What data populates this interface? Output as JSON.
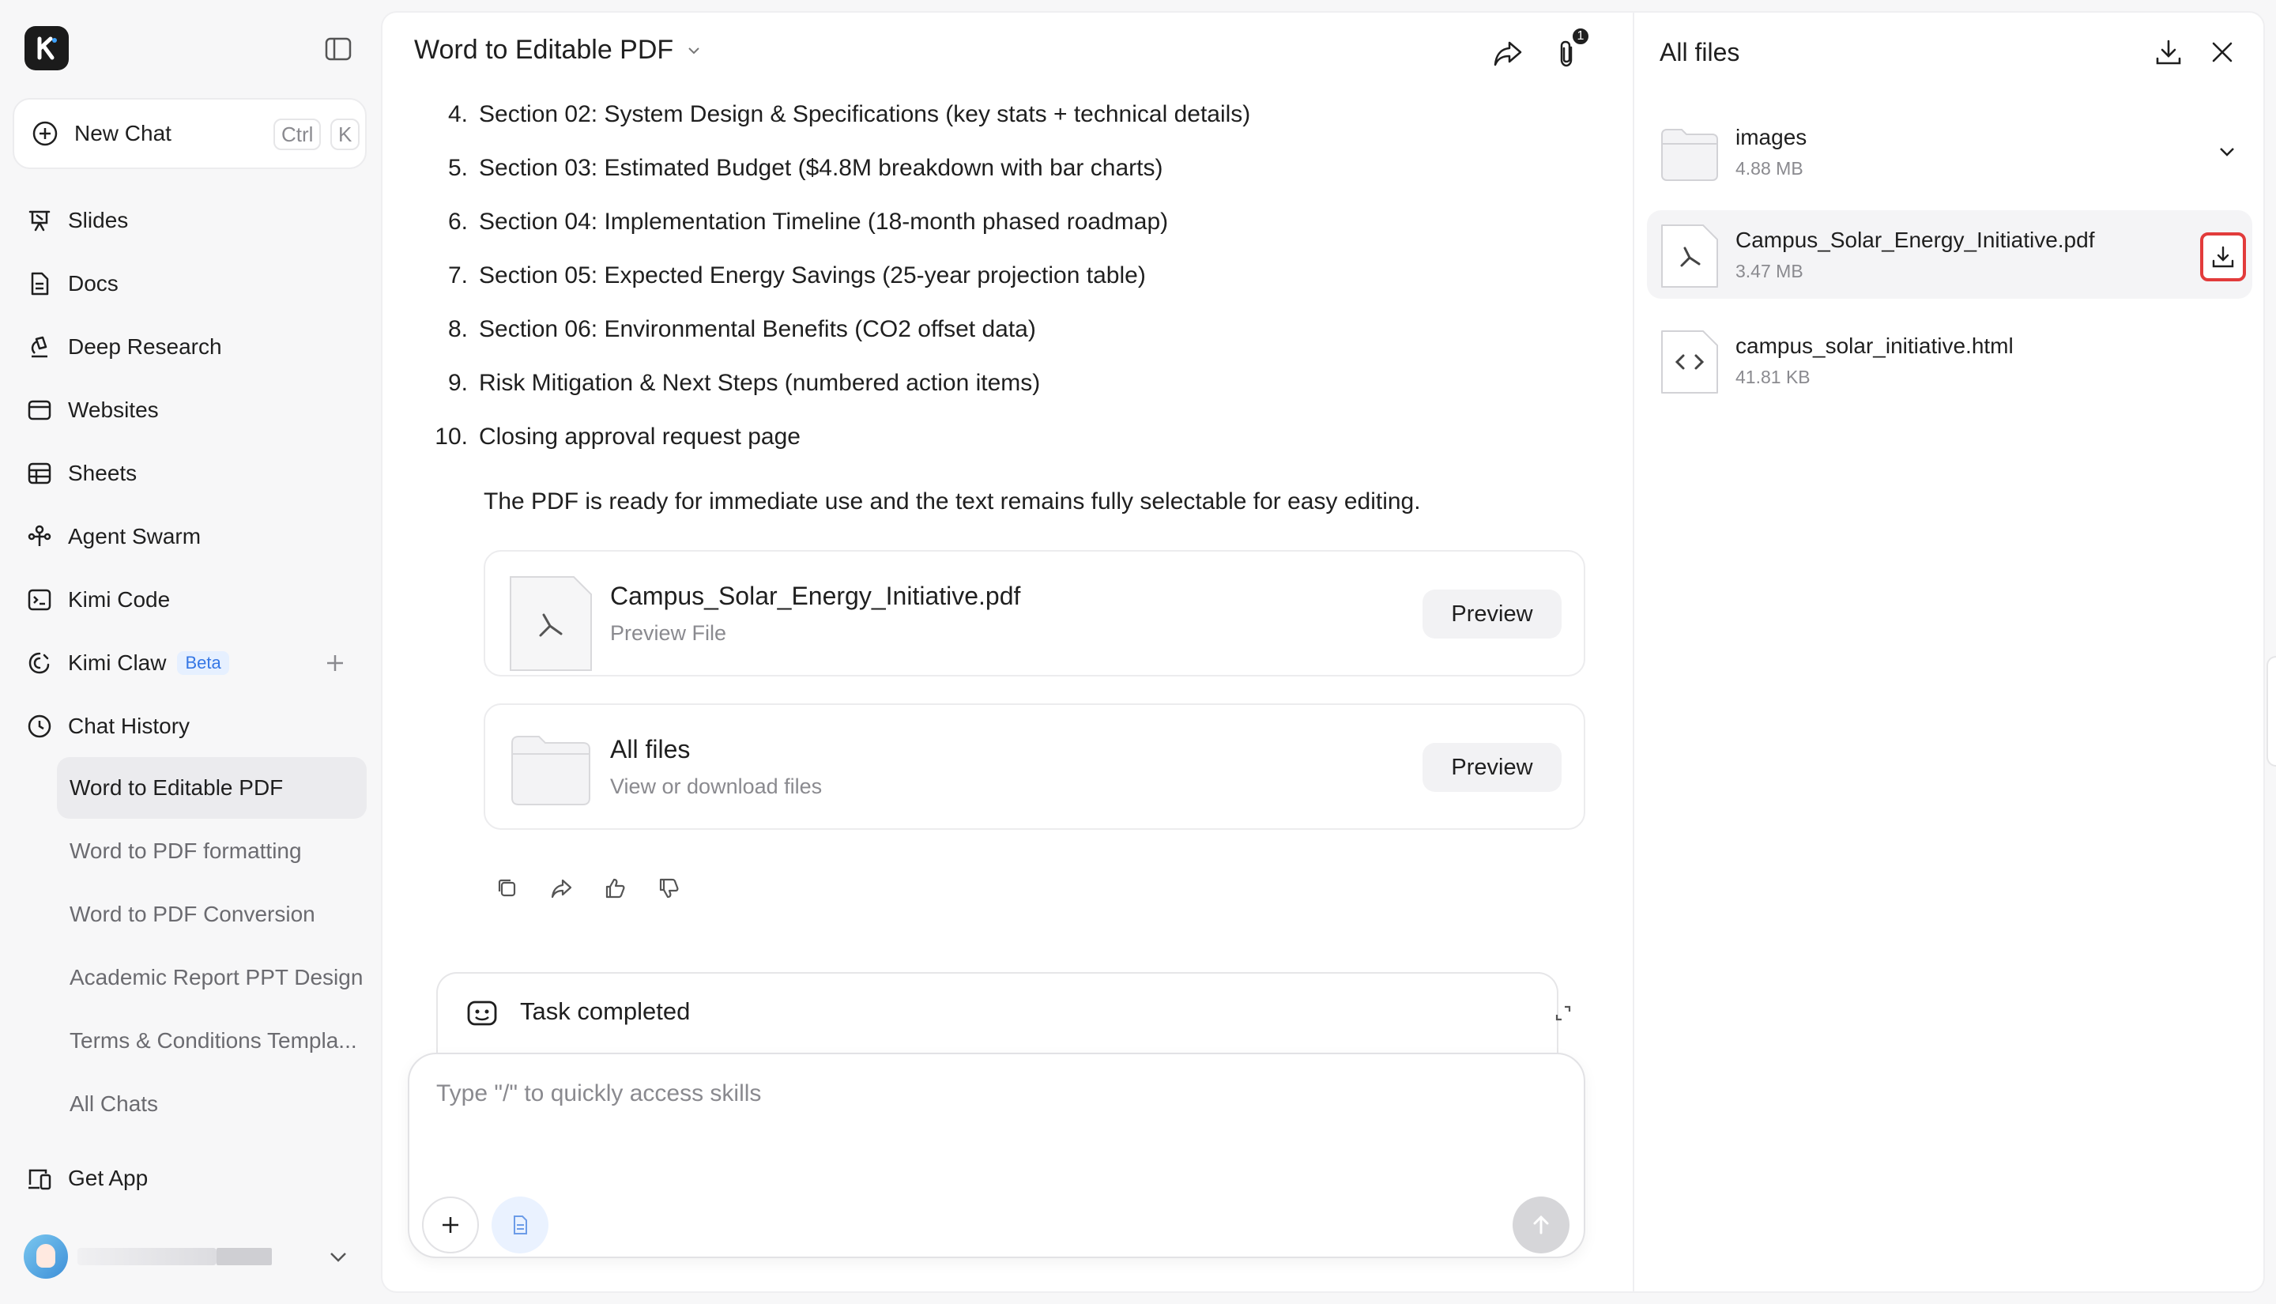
{
  "sidebar": {
    "logo": "kimi-logo",
    "new_chat": {
      "label": "New Chat",
      "shortcut_1": "Ctrl",
      "shortcut_2": "K"
    },
    "nav": [
      {
        "label": "Slides",
        "icon": "slides-icon"
      },
      {
        "label": "Docs",
        "icon": "docs-icon"
      },
      {
        "label": "Deep Research",
        "icon": "deep-research-icon"
      },
      {
        "label": "Websites",
        "icon": "websites-icon"
      },
      {
        "label": "Sheets",
        "icon": "sheets-icon"
      },
      {
        "label": "Agent Swarm",
        "icon": "agent-swarm-icon"
      },
      {
        "label": "Kimi Code",
        "icon": "code-icon"
      },
      {
        "label": "Kimi Claw",
        "icon": "claw-icon",
        "badge": "Beta"
      },
      {
        "label": "Chat History",
        "icon": "clock-icon"
      }
    ],
    "history": [
      "Word to Editable PDF",
      "Word to PDF formatting",
      "Word to PDF Conversion",
      "Academic Report PPT Design",
      "Terms & Conditions Templa...",
      "All Chats"
    ],
    "get_app": "Get App"
  },
  "main": {
    "title": "Word to Editable PDF",
    "attachment_count": "1",
    "list": [
      {
        "num": "4.",
        "text": "Section 02: System Design & Specifications (key stats + technical details)"
      },
      {
        "num": "5.",
        "text": "Section 03: Estimated Budget ($4.8M breakdown with bar charts)"
      },
      {
        "num": "6.",
        "text": "Section 04: Implementation Timeline (18-month phased roadmap)"
      },
      {
        "num": "7.",
        "text": "Section 05: Expected Energy Savings (25-year projection table)"
      },
      {
        "num": "8.",
        "text": "Section 06: Environmental Benefits (CO2 offset data)"
      },
      {
        "num": "9.",
        "text": "Risk Mitigation & Next Steps (numbered action items)"
      },
      {
        "num": "10.",
        "text": "Closing approval request page"
      }
    ],
    "summary": "The PDF is ready for immediate use and the text remains fully selectable for easy editing.",
    "cards": [
      {
        "title": "Campus_Solar_Energy_Initiative.pdf",
        "subtitle": "Preview File",
        "button": "Preview"
      },
      {
        "title": "All files",
        "subtitle": "View or download files",
        "button": "Preview"
      }
    ],
    "task_status": "Task completed",
    "composer_placeholder": "Type \"/\" to quickly access skills"
  },
  "files_panel": {
    "title": "All files",
    "items": [
      {
        "name": "images",
        "size": "4.88 MB",
        "type": "folder"
      },
      {
        "name": "Campus_Solar_Energy_Initiative.pdf",
        "size": "3.47 MB",
        "type": "pdf"
      },
      {
        "name": "campus_solar_initiative.html",
        "size": "41.81 KB",
        "type": "html"
      }
    ]
  },
  "colors": {
    "accent_blue": "#3577e5",
    "highlight_red": "#e23b3b",
    "sidebar_bg": "#f7f7f8",
    "active_bg": "#ebebee"
  }
}
